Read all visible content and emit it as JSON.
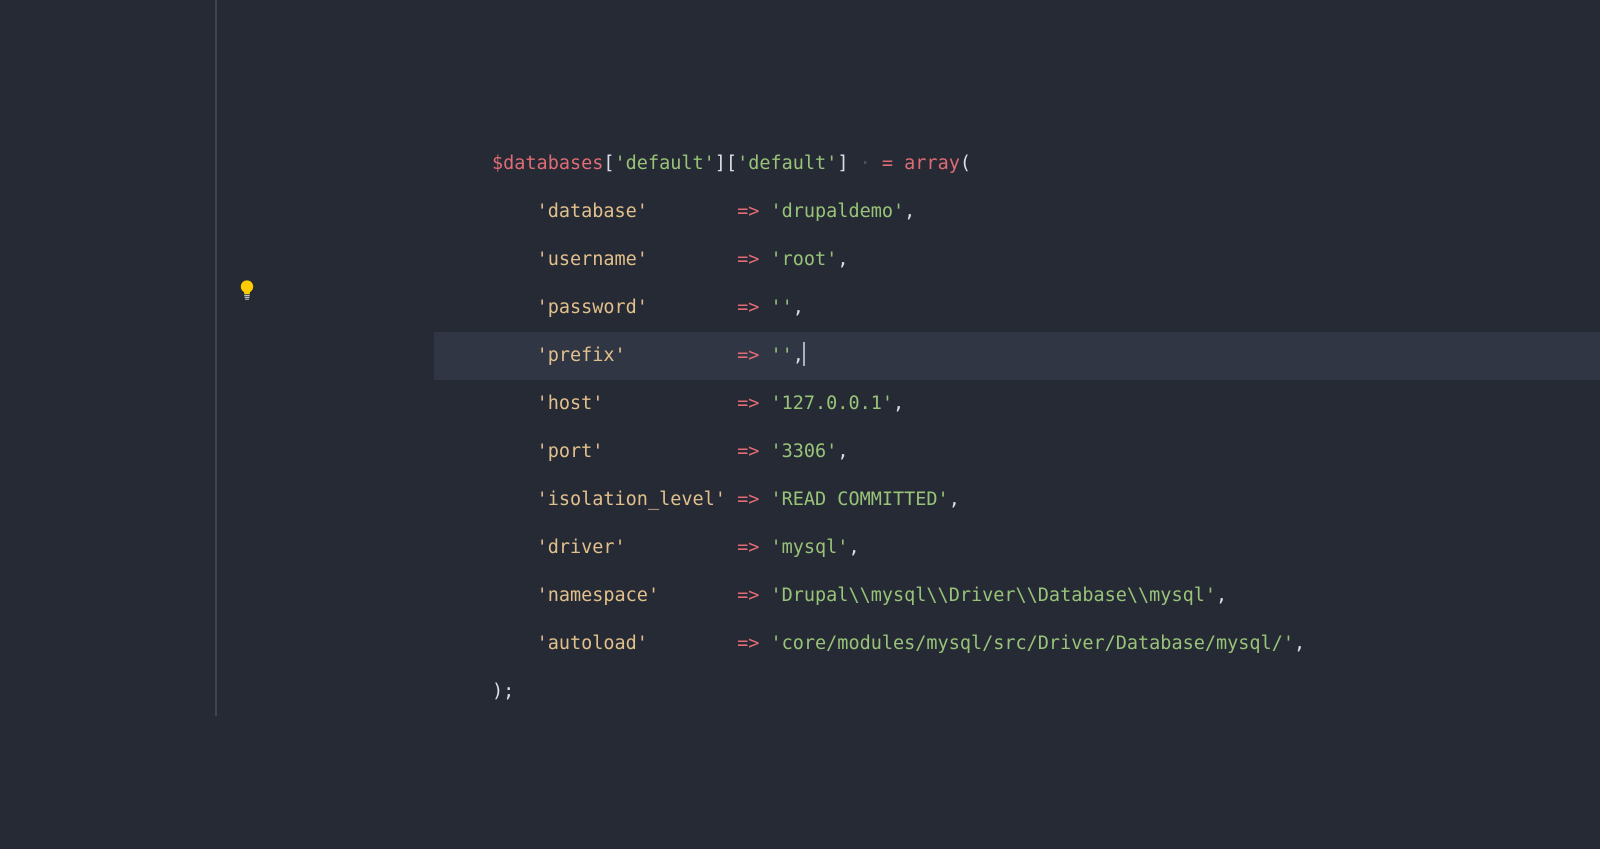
{
  "colors": {
    "bg": "#252a34",
    "current_line": "#2c313c",
    "variable": "#e06c75",
    "string_key": "#e2c08d",
    "string_val": "#98c379",
    "operator": "#e06c75",
    "keyword": "#e06c75",
    "punct": "#abb2bf"
  },
  "gutter": {
    "lightbulb_line": 3
  },
  "code": {
    "variable": "$databases",
    "index1": "'default'",
    "index2": "'default'",
    "assign": "=",
    "array_kw": "array",
    "entries": [
      {
        "key": "'database'",
        "padkey": "'database'       ",
        "val": "'drupaldemo'"
      },
      {
        "key": "'username'",
        "padkey": "'username'       ",
        "val": "'root'"
      },
      {
        "key": "'password'",
        "padkey": "'password'       ",
        "val": "''"
      },
      {
        "key": "'prefix'",
        "padkey": "'prefix'         ",
        "val": "''"
      },
      {
        "key": "'host'",
        "padkey": "'host'           ",
        "val": "'127.0.0.1'"
      },
      {
        "key": "'port'",
        "padkey": "'port'           ",
        "val": "'3306'"
      },
      {
        "key": "'isolation_level'",
        "padkey": "'isolation_level'",
        "val": "'READ COMMITTED'"
      },
      {
        "key": "'driver'",
        "padkey": "'driver'         ",
        "val": "'mysql'"
      },
      {
        "key": "'namespace'",
        "padkey": "'namespace'      ",
        "val": "'Drupal\\\\mysql\\\\Driver\\\\Database\\\\mysql'"
      },
      {
        "key": "'autoload'",
        "padkey": "'autoload'       ",
        "val": "'core/modules/mysql/src/Driver/Database/mysql/'"
      }
    ],
    "close": ");",
    "arrow": "=>",
    "comma": ",",
    "current_line_index": 3
  }
}
